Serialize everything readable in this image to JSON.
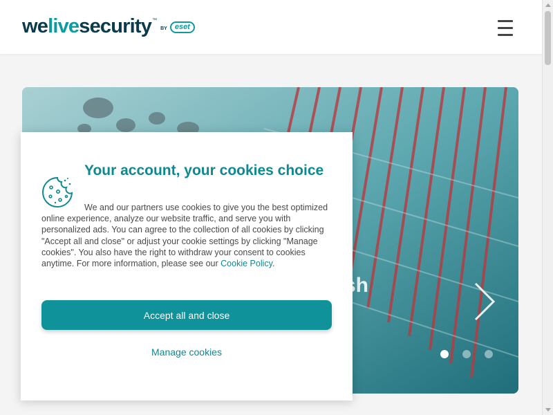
{
  "header": {
    "logo_we": "we",
    "logo_live": "live",
    "logo_security": "security",
    "logo_tm": "™",
    "logo_by": "BY",
    "logo_brand": "eset",
    "menu_icon": "hamburger-menu-icon"
  },
  "hero": {
    "title_fragment": "sh",
    "next_icon": "chevron-right-icon",
    "slides_count": 3,
    "active_slide": 1
  },
  "cookie_modal": {
    "title": "Your account, your cookies choice",
    "icon": "cookie-icon",
    "body": "We and our partners use cookies to give you the best optimized online experience, analyze our website traffic, and serve you with personalized ads. You can agree to the collection of all cookies by clicking \"Accept all and close\" or adjust your cookie settings by clicking \"Manage cookies\". You also have the right to withdraw your consent to cookies anytime. For more information, please see our ",
    "policy_link": "Cookie Policy",
    "body_end": ".",
    "accept_label": "Accept all and close",
    "manage_label": "Manage cookies"
  },
  "colors": {
    "brand_teal": "#0d9b9f",
    "button_teal": "#0f929a",
    "logo_dark": "#0b3a4a"
  }
}
